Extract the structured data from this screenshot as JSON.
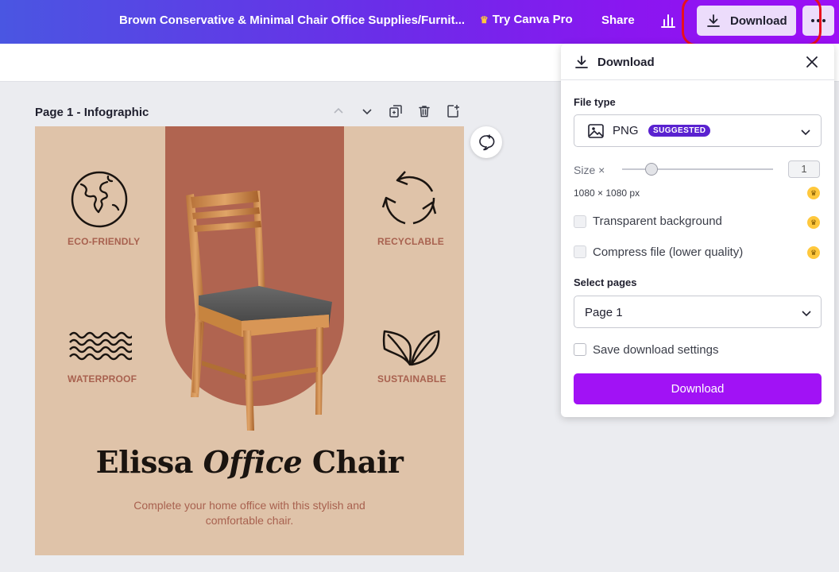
{
  "topbar": {
    "doc_title": "Brown Conservative & Minimal Chair Office Supplies/Furnit...",
    "try_pro": "Try Canva Pro",
    "share": "Share",
    "download": "Download"
  },
  "page": {
    "label": "Page 1 - Infographic"
  },
  "design": {
    "features": [
      "ECO-FRIENDLY",
      "RECYCLABLE",
      "WATERPROOF",
      "SUSTAINABLE"
    ],
    "headline_part1": "Elissa ",
    "headline_italic": "Office",
    "headline_part2": " Chair",
    "subcopy": "Complete your home office with this stylish and comfortable chair.",
    "colors": {
      "background": "#dfc3a9",
      "arch": "#b06450",
      "accent_text": "#a8614f"
    }
  },
  "download_panel": {
    "title": "Download",
    "file_type_label": "File type",
    "file_type": "PNG",
    "file_type_badge": "SUGGESTED",
    "size_label": "Size ×",
    "size_value": "1",
    "dimensions": "1080 × 1080 px",
    "transparent_label": "Transparent background",
    "compress_label": "Compress file (lower quality)",
    "select_pages_label": "Select pages",
    "pages_value": "Page 1",
    "save_settings_label": "Save download settings",
    "download_button": "Download",
    "accent": "#a112f5"
  }
}
